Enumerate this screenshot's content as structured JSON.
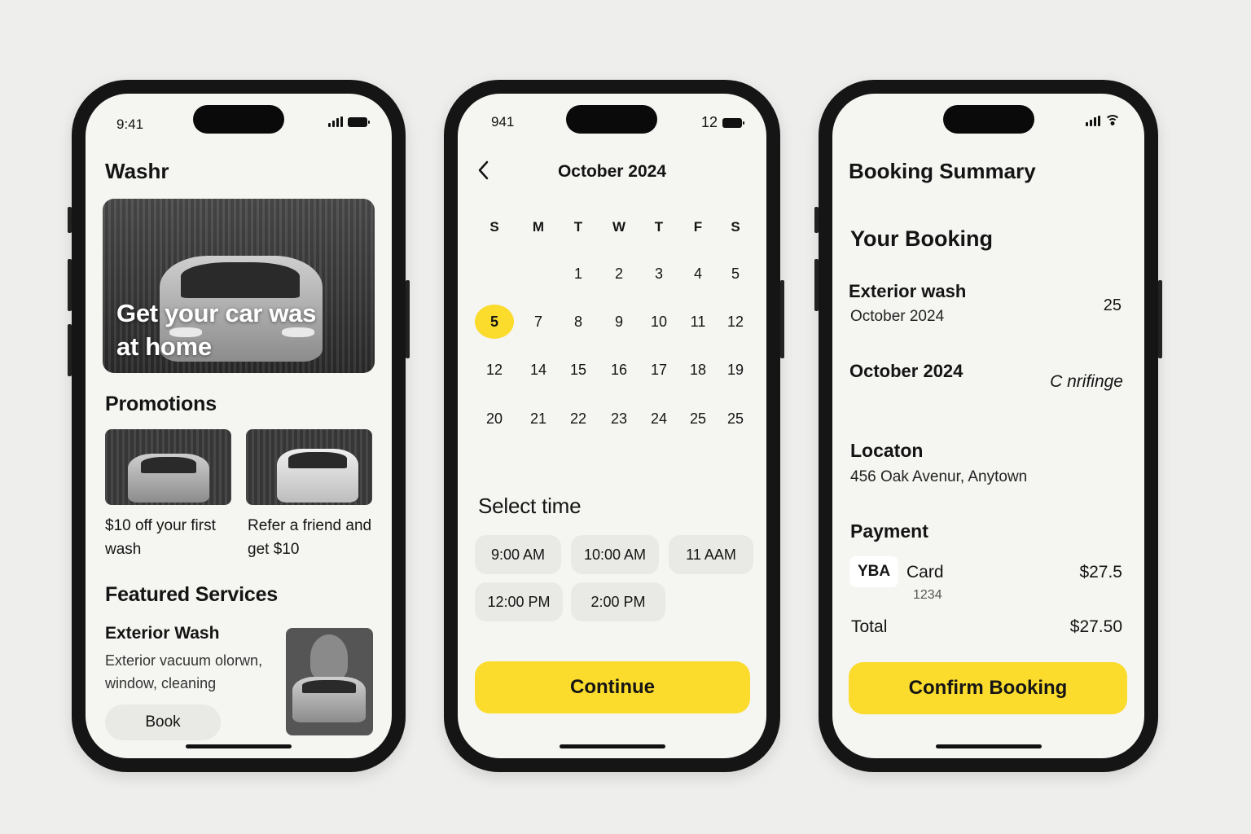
{
  "accent_color": "#FBDB2B",
  "screen1": {
    "status_time": "9:41",
    "app_title": "Washr",
    "hero_text": "Get your car was at home",
    "promotions_heading": "Promotions",
    "promotions": [
      {
        "text": "$10 off your first wash"
      },
      {
        "text": "Refer a friend and get $10"
      }
    ],
    "featured_heading": "Featured Services",
    "service": {
      "title": "Exterior Wash",
      "description": "Exterior vacuum olorwn, window, cleaning",
      "book_label": "Book"
    }
  },
  "screen2": {
    "status_time": "941",
    "status_right": "12",
    "month_label": "October 2024",
    "weekdays": [
      "S",
      "M",
      "T",
      "W",
      "T",
      "F",
      "S"
    ],
    "rows": [
      [
        "",
        "",
        "1",
        "2",
        "3",
        "4",
        "5"
      ],
      [
        "5",
        "7",
        "8",
        "9",
        "10",
        "11",
        "12"
      ],
      [
        "12",
        "14",
        "15",
        "16",
        "17",
        "18",
        "19"
      ],
      [
        "20",
        "21",
        "22",
        "23",
        "24",
        "25",
        "25"
      ]
    ],
    "selected_day": "5",
    "select_time_heading": "Select time",
    "times": [
      "9:00 AM",
      "10:00 AM",
      "11 AAM",
      "12:00 PM",
      "2:00 PM"
    ],
    "continue_label": "Continue"
  },
  "screen3": {
    "title": "Booking Summary",
    "your_booking": "Your Booking",
    "service_name": "Exterior wash",
    "service_date": "October 2024",
    "service_value": "25",
    "date_label": "October 2024",
    "date_value": "C nrifinge",
    "location_label": "Locaton",
    "location_value": "456 Oak Avenur, Anytown",
    "payment_label": "Payment",
    "card_badge": "YBA",
    "card_label": "Card",
    "card_number": "1234",
    "card_amount": "$27.5",
    "total_label": "Total",
    "total_value": "$27.50",
    "confirm_label": "Confirm Booking"
  }
}
